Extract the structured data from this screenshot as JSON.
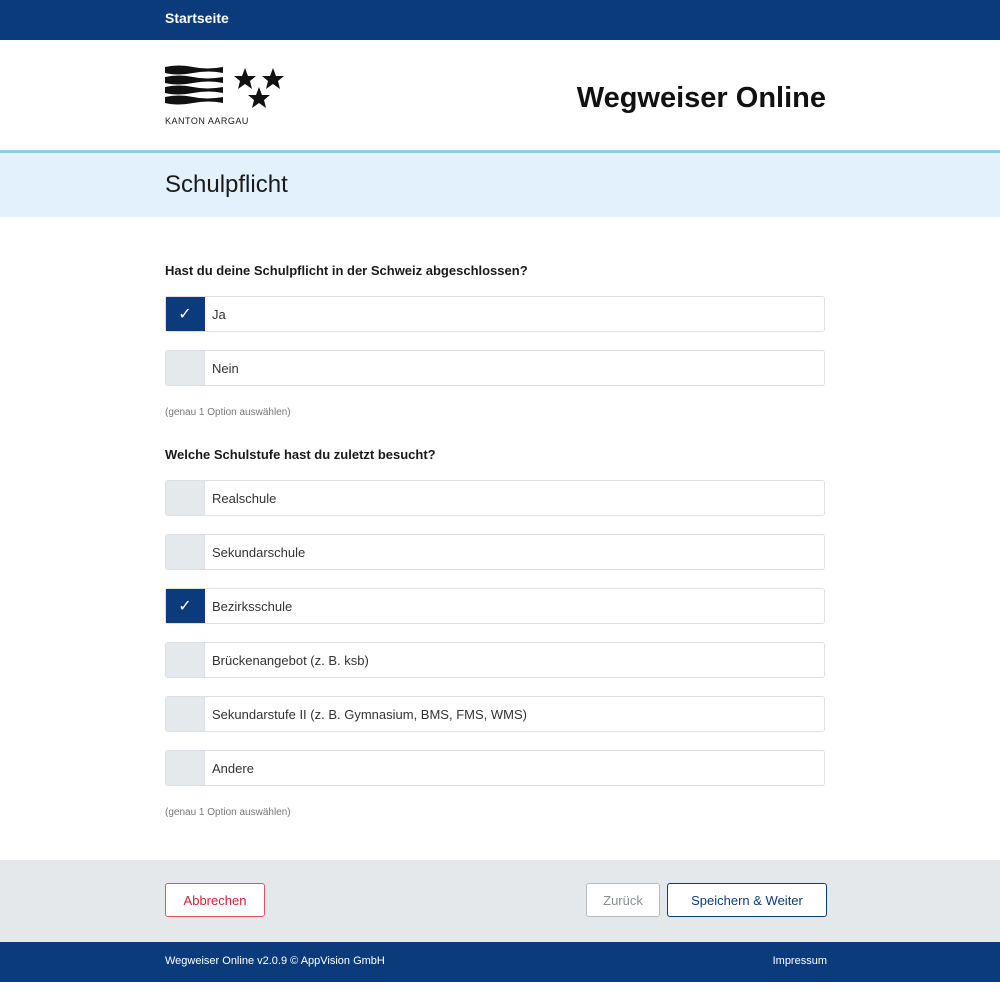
{
  "topbar": {
    "home_link": "Startseite"
  },
  "header": {
    "logo_text": "KANTON AARGAU",
    "logo_icon": "kanton-aargau-coat-of-arms",
    "app_title": "Wegweiser Online"
  },
  "page": {
    "title": "Schulpflicht"
  },
  "form": {
    "q1": {
      "label": "Hast du deine Schulpflicht in der Schweiz abgeschlossen?",
      "options": [
        {
          "label": "Ja",
          "checked": true
        },
        {
          "label": "Nein",
          "checked": false
        }
      ],
      "hint": "(genau 1 Option auswählen)"
    },
    "q2": {
      "label": "Welche Schulstufe hast du zuletzt besucht?",
      "options": [
        {
          "label": "Realschule",
          "checked": false
        },
        {
          "label": "Sekundarschule",
          "checked": false
        },
        {
          "label": "Bezirksschule",
          "checked": true
        },
        {
          "label": "Brückenangebot (z. B. ksb)",
          "checked": false
        },
        {
          "label": "Sekundarstufe II (z. B. Gymnasium, BMS, FMS, WMS)",
          "checked": false
        },
        {
          "label": "Andere",
          "checked": false
        }
      ],
      "hint": "(genau 1 Option auswählen)"
    }
  },
  "actions": {
    "cancel_label": "Abbrechen",
    "back_label": "Zurück",
    "next_label": "Speichern & Weiter"
  },
  "footer": {
    "copyright": "Wegweiser Online v2.0.9 © AppVision GmbH",
    "impressum_link": "Impressum"
  },
  "colors": {
    "brand_blue": "#0c3b7c",
    "title_band": "#e2f1fb",
    "title_band_border": "#8ccbee",
    "cancel_red": "#d3203a",
    "action_bar": "#e5e8eb"
  }
}
